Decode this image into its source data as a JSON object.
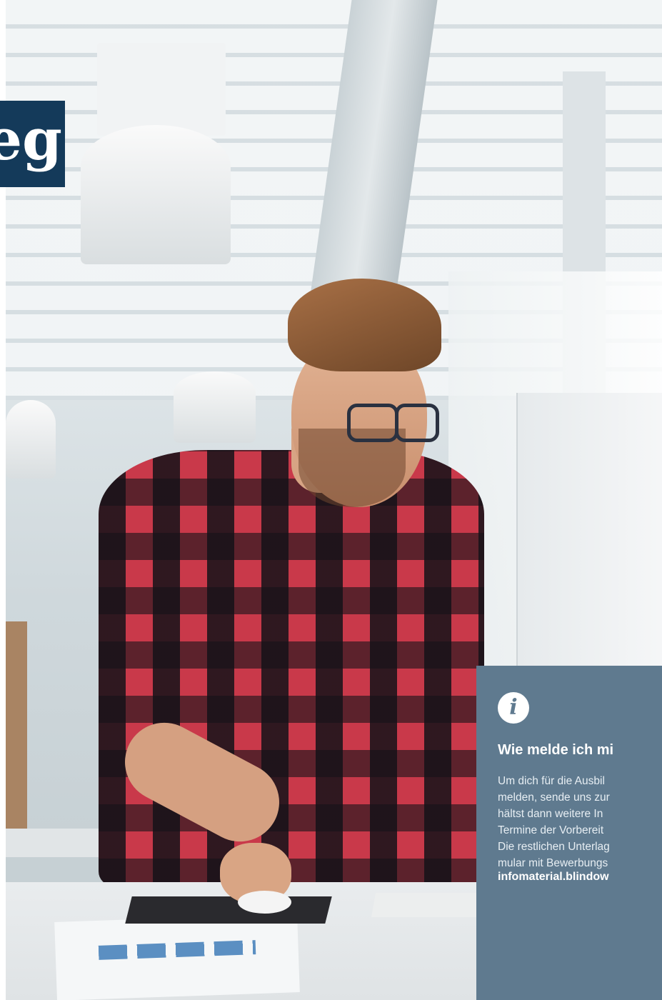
{
  "title": {
    "text": "eg"
  },
  "info_panel": {
    "icon": "info-icon",
    "icon_glyph": "i",
    "heading": "Wie melde ich mi",
    "body_lines": [
      "Um dich für die Ausbil",
      "melden, sende uns zur",
      "hältst dann weitere In",
      "Termine der Vorbereit",
      "Die restlichen Unterlag",
      "mular mit Bewerbungs"
    ],
    "link": "infomaterial.blindow"
  },
  "colors": {
    "title_background": "#143a5a",
    "panel_background": "#5f7a8f",
    "text_on_dark": "#ffffff"
  }
}
